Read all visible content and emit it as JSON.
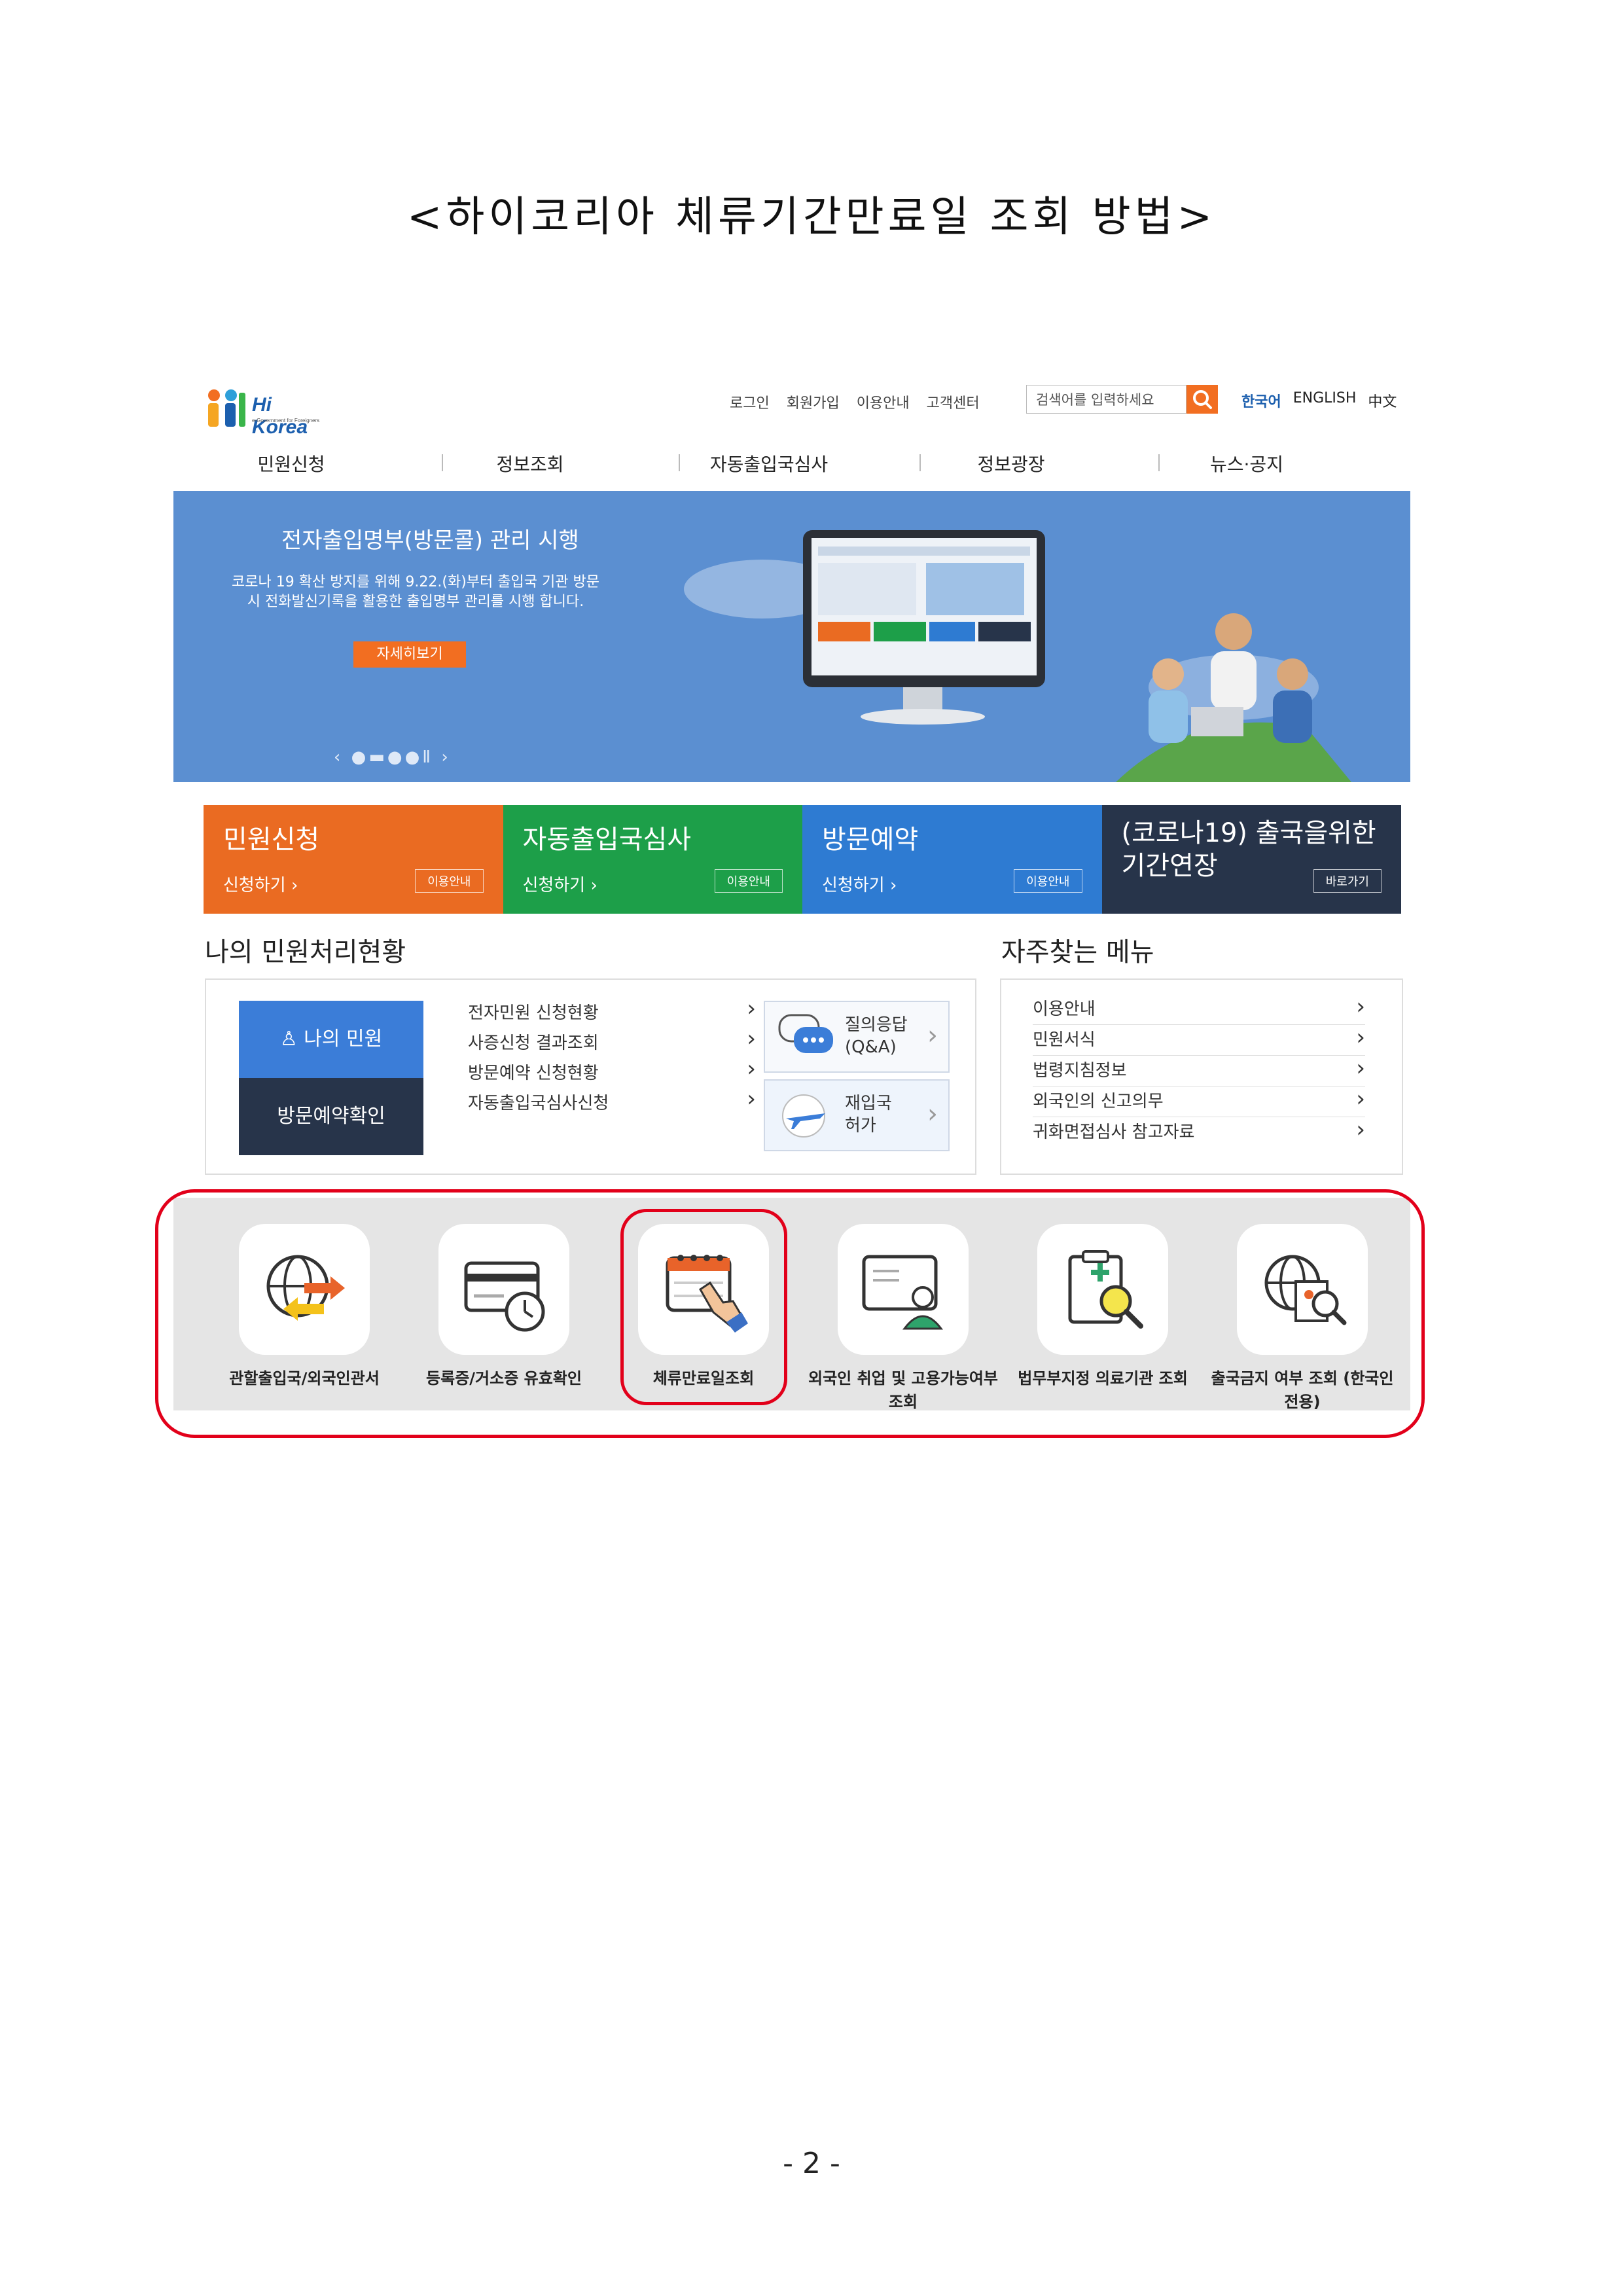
{
  "document": {
    "title": "<하이코리아 체류기간만료일 조회 방법>",
    "page_number": "- 2 -"
  },
  "header": {
    "logo_text": "Hi Korea",
    "logo_sub": "e-Government for Foreigners",
    "links": [
      "로그인",
      "회원가입",
      "이용안내",
      "고객센터"
    ],
    "search_placeholder": "검색어를 입력하세요",
    "languages": [
      "한국어",
      "ENGLISH",
      "中文"
    ]
  },
  "nav": [
    "민원신청",
    "정보조회",
    "자동출입국심사",
    "정보광장",
    "뉴스·공지"
  ],
  "banner": {
    "title": "전자출입명부(방문콜) 관리 시행",
    "desc": "코로나 19 확산 방지를 위해 9.22.(화)부터 출입국 기관 방문 시 전화발신기록을 활용한 출입명부 관리를 시행 합니다.",
    "button": "자세히보기"
  },
  "tiles": [
    {
      "title": "민원신청",
      "sub": "신청하기 ›",
      "btn": "이용안내",
      "color": "#ea6b22"
    },
    {
      "title": "자동출입국심사",
      "sub": "신청하기 ›",
      "btn": "이용안내",
      "color": "#1d9f49"
    },
    {
      "title": "방문예약",
      "sub": "신청하기 ›",
      "btn": "이용안내",
      "color": "#2e7bd2"
    },
    {
      "title": "(코로나19) 출국을위한 기간연장",
      "sub": "",
      "btn": "바로가기",
      "color": "#27344a"
    }
  ],
  "my_status": {
    "title": "나의 민원처리현황",
    "my_button": "나의 민원",
    "visit_button": "방문예약확인",
    "items": [
      "전자민원 신청현황",
      "사증신청 결과조회",
      "방문예약 신청현황",
      "자동출입국심사신청"
    ],
    "qa_label": "질의응답 (Q&A)",
    "reentry_label": "재입국 허가"
  },
  "frequent": {
    "title": "자주찾는 메뉴",
    "items": [
      "이용안내",
      "민원서식",
      "법령지침정보",
      "외국인의 신고의무",
      "귀화면접심사 참고자료"
    ]
  },
  "quick_menu": [
    {
      "icon": "globe-arrows-icon",
      "label": "관할출입국/외국인관서"
    },
    {
      "icon": "card-clock-icon",
      "label": "등록증/거소증 유효확인"
    },
    {
      "icon": "calendar-hand-icon",
      "label": "체류만료일조회",
      "highlighted": true
    },
    {
      "icon": "worker-screen-icon",
      "label": "외국인 취업 및 고용가능여부 조회"
    },
    {
      "icon": "clipboard-search-icon",
      "label": "법무부지정 의료기관 조회"
    },
    {
      "icon": "globe-document-search-icon",
      "label": "출국금지 여부 조회 (한국인 전용)"
    }
  ],
  "colors": {
    "highlight": "#e2001a",
    "accent": "#f26e21",
    "brand": "#1c5fae"
  }
}
